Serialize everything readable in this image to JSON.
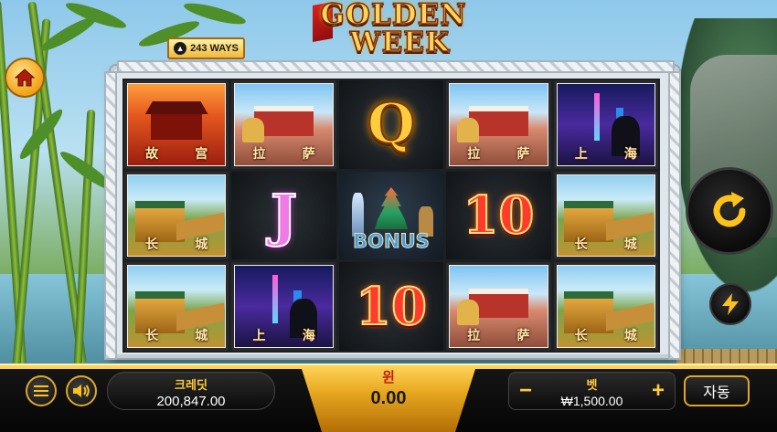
{
  "logo": {
    "line1": "GOLDEN",
    "line2": "WEEK"
  },
  "ways_badge": {
    "label": "243 WAYS"
  },
  "icons": {
    "home": "home-icon",
    "spin": "spin-icon",
    "turbo": "lightning-icon",
    "menu": "menu-icon",
    "sound": "speaker-icon",
    "ways": "arrow-up-icon"
  },
  "reels": {
    "cells": [
      {
        "symbol": "gugong",
        "label_1": "故",
        "label_2": "宫"
      },
      {
        "symbol": "lasa",
        "label_1": "拉",
        "label_2": "萨"
      },
      {
        "symbol": "Q"
      },
      {
        "symbol": "lasa",
        "label_1": "拉",
        "label_2": "萨"
      },
      {
        "symbol": "shanghai",
        "label_1": "上",
        "label_2": "海"
      },
      {
        "symbol": "changcheng",
        "label_1": "长",
        "label_2": "城"
      },
      {
        "symbol": "J"
      },
      {
        "symbol": "bonus",
        "text": "BONUS"
      },
      {
        "symbol": "10"
      },
      {
        "symbol": "changcheng",
        "label_1": "长",
        "label_2": "城"
      },
      {
        "symbol": "changcheng",
        "label_1": "长",
        "label_2": "城"
      },
      {
        "symbol": "shanghai",
        "label_1": "上",
        "label_2": "海"
      },
      {
        "symbol": "10"
      },
      {
        "symbol": "lasa",
        "label_1": "拉",
        "label_2": "萨"
      },
      {
        "symbol": "changcheng",
        "label_1": "长",
        "label_2": "城"
      }
    ],
    "text": {
      "q": "Q",
      "ten": "10",
      "j": "J"
    }
  },
  "bottom_bar": {
    "credit_label": "크레딧",
    "credit_value": "200,847.00",
    "win_label": "윈",
    "win_value": "0.00",
    "bet_label": "벳",
    "bet_value": "₩1,500.00",
    "bet_minus": "−",
    "bet_plus": "+",
    "auto_label": "자동"
  },
  "colors": {
    "accent_gold": "#ffcb39",
    "win_red": "#c11a10"
  }
}
